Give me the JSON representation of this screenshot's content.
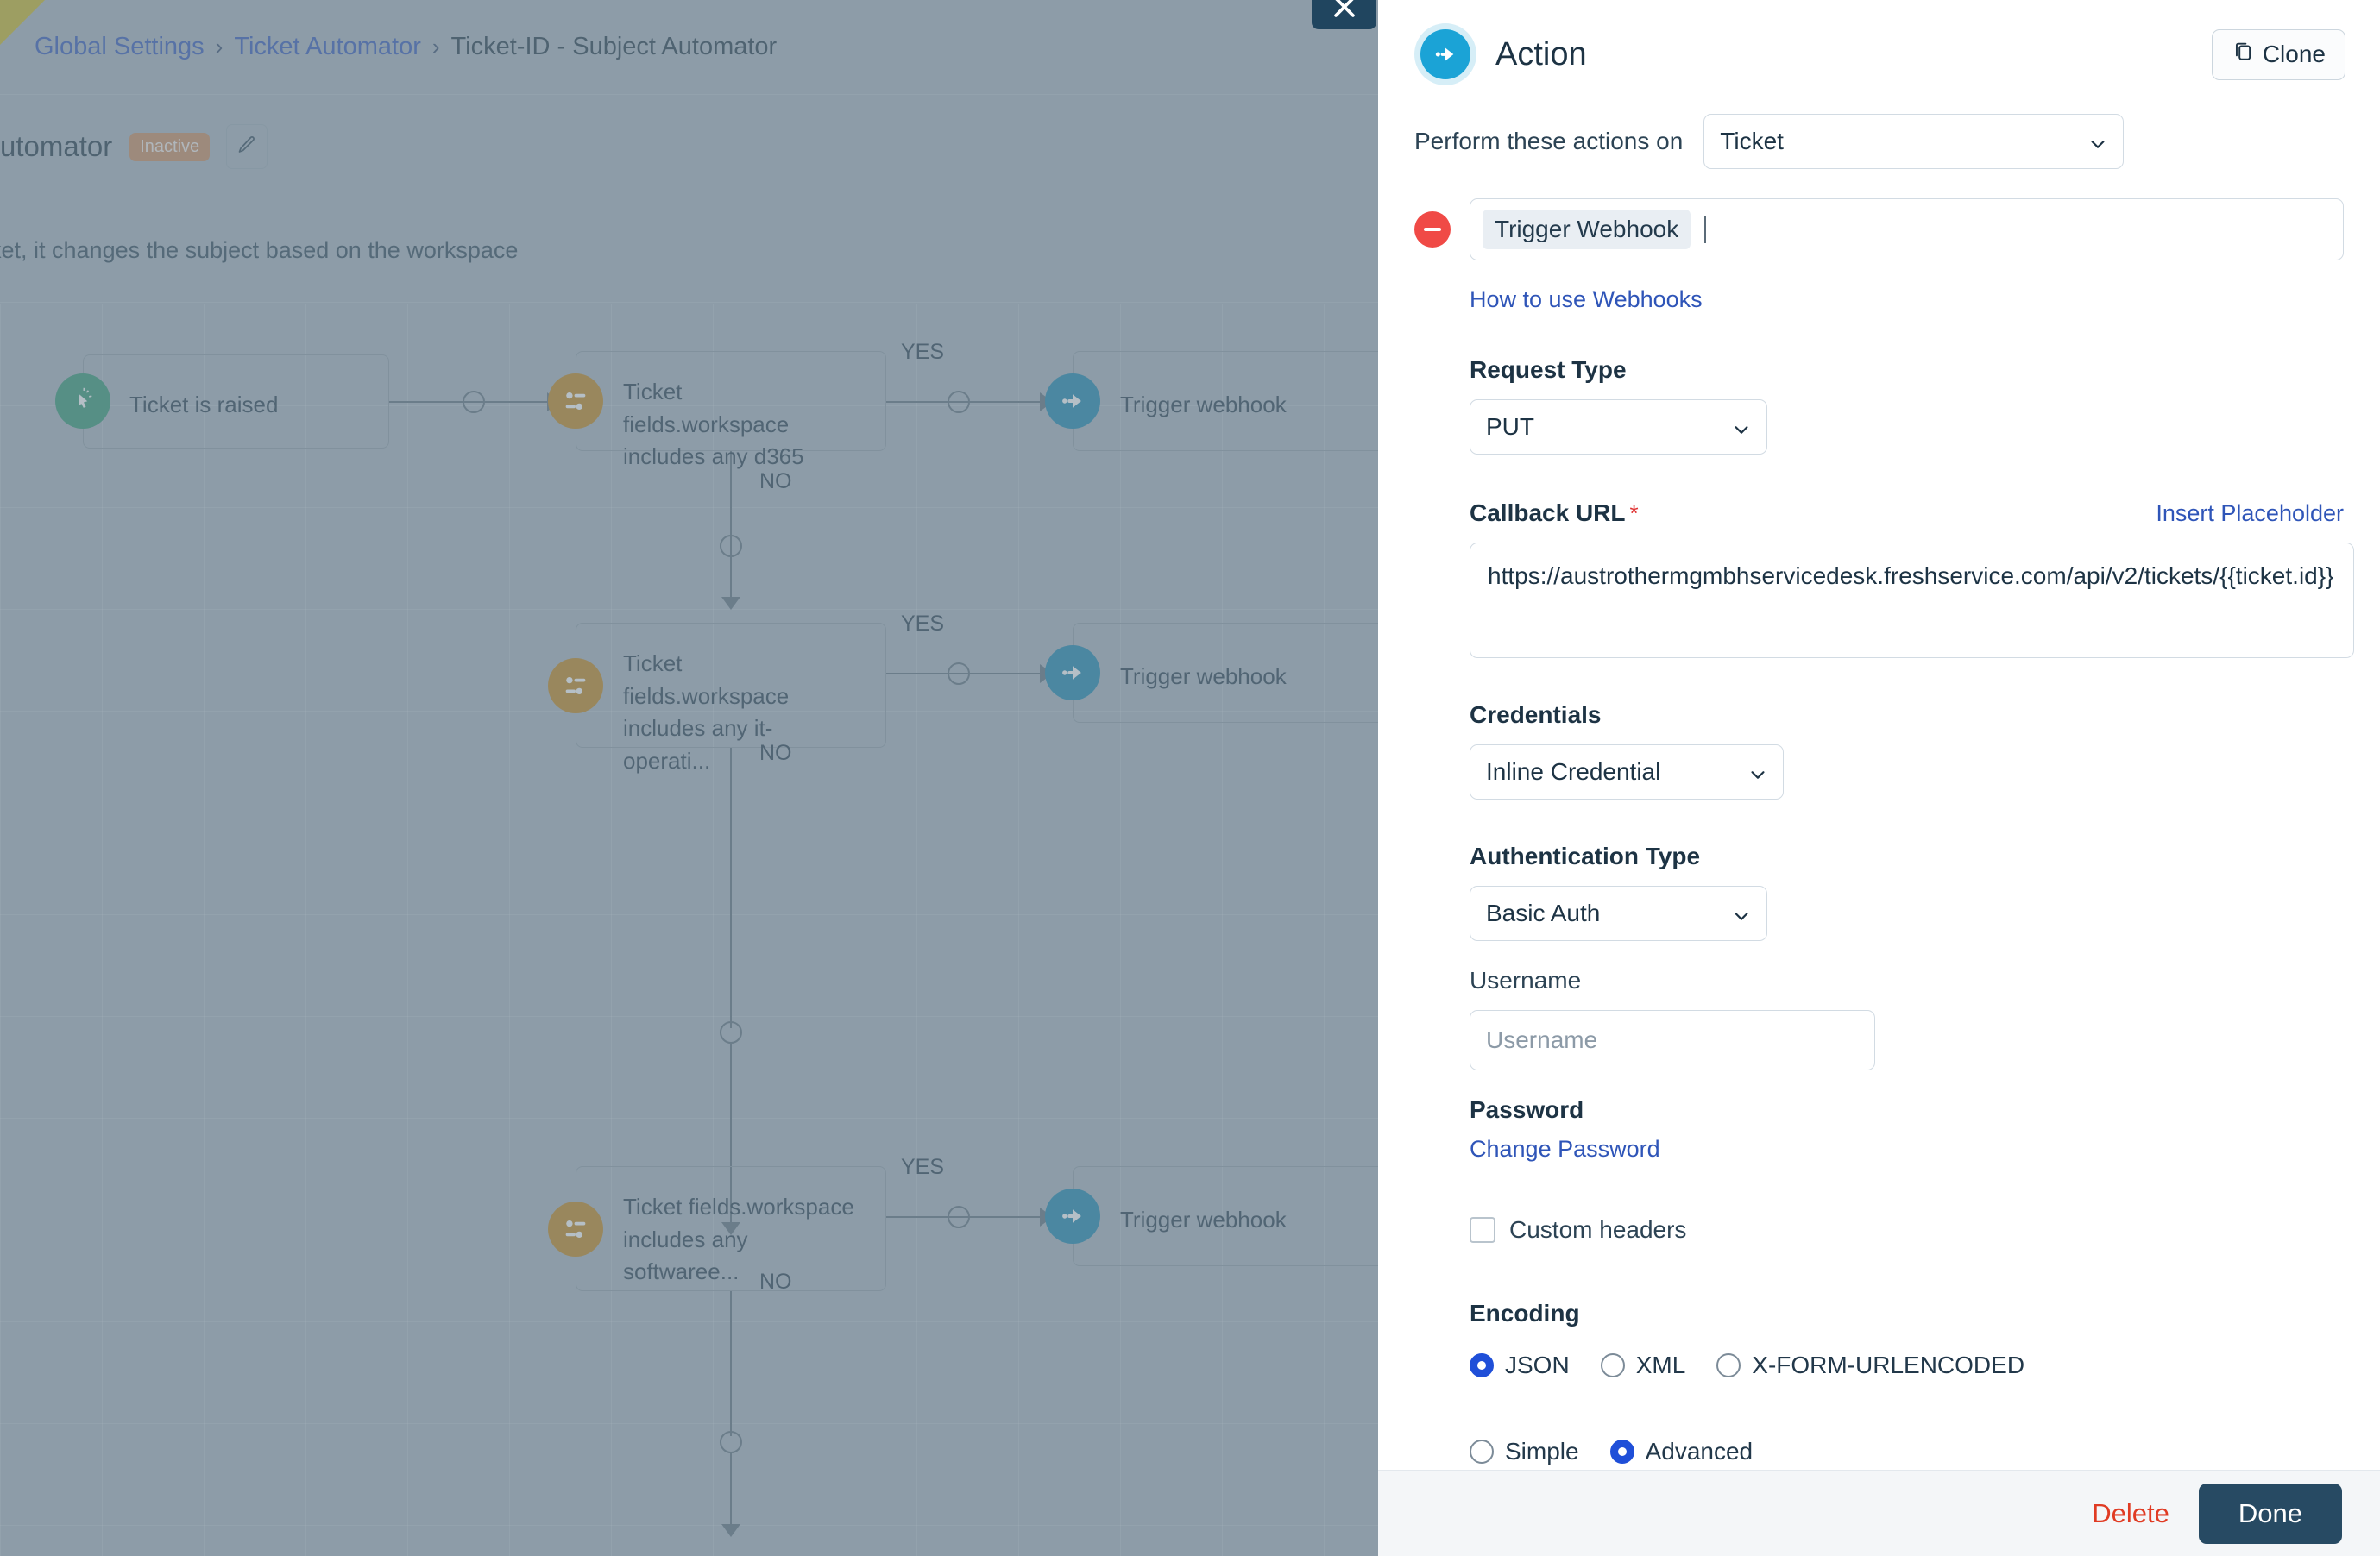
{
  "background": {
    "breadcrumb": {
      "items": [
        "Global Settings",
        "Ticket Automator",
        "Ticket-ID - Subject Automator"
      ],
      "separator": "›"
    },
    "page_title": "Automator",
    "status_badge": "Inactive",
    "edit_icon": "pencil-icon",
    "description": "ket, it changes the subject based on the workspace",
    "close_icon": "close-icon"
  },
  "workflow": {
    "nodes": [
      {
        "id": "trigger",
        "label": "Ticket is raised",
        "icon": "trigger-icon",
        "color": "#2e9470"
      },
      {
        "id": "cond1",
        "label": "Ticket fields.workspace includes any d365",
        "icon": "condition-icon",
        "color": "#c18317"
      },
      {
        "id": "act1",
        "label": "Trigger webhook",
        "icon": "action-icon",
        "color": "#1683ad"
      },
      {
        "id": "cond2",
        "label": "Ticket fields.workspace includes any it-operati...",
        "icon": "condition-icon",
        "color": "#c18317"
      },
      {
        "id": "act2",
        "label": "Trigger webhook",
        "icon": "action-icon",
        "color": "#1683ad"
      },
      {
        "id": "cond3",
        "label": "Ticket fields.workspace includes any softwaree...",
        "icon": "condition-icon",
        "color": "#c18317"
      },
      {
        "id": "act3",
        "label": "Trigger webhook",
        "icon": "action-icon",
        "color": "#1683ad"
      }
    ],
    "edge_labels": {
      "yes": "YES",
      "no": "NO"
    }
  },
  "drawer": {
    "title": "Action",
    "title_icon": "action-arrow-icon",
    "clone_label": "Clone",
    "clone_icon": "copy-icon",
    "perform_label": "Perform these actions on",
    "perform_value": "Ticket",
    "remove_icon": "minus-circle-icon",
    "action_token": "Trigger Webhook",
    "how_to_link": "How to use Webhooks",
    "request_type_label": "Request Type",
    "request_type_value": "PUT",
    "callback_url_label": "Callback URL",
    "required_marker": "*",
    "insert_placeholder_link": "Insert Placeholder",
    "callback_url_value": "https://austrothermgmbhservicedesk.freshservice.com/api/v2/tickets/{{ticket.id}}",
    "credentials_label": "Credentials",
    "credentials_value": "Inline Credential",
    "auth_type_label": "Authentication Type",
    "auth_type_value": "Basic Auth",
    "username_label": "Username",
    "username_value": "",
    "username_placeholder": "Username",
    "password_label": "Password",
    "change_password_link": "Change Password",
    "custom_headers_label": "Custom headers",
    "custom_headers_checked": false,
    "encoding_label": "Encoding",
    "encoding_options": [
      {
        "label": "JSON",
        "selected": true
      },
      {
        "label": "XML",
        "selected": false
      },
      {
        "label": "X-FORM-URLENCODED",
        "selected": false
      }
    ],
    "mode_options": [
      {
        "label": "Simple",
        "selected": false
      },
      {
        "label": "Advanced",
        "selected": true
      }
    ],
    "delete_label": "Delete",
    "done_label": "Done"
  },
  "colors": {
    "accent_blue": "#1ba3d6",
    "link_blue": "#2f55b8",
    "danger_red": "#e03b23",
    "done_navy": "#274a63",
    "trigger_green": "#2e9470",
    "condition_orange": "#c18317",
    "action_blue": "#1683ad",
    "inactive_badge": "#c98a5c",
    "radio_selected": "#1f4fd8"
  }
}
